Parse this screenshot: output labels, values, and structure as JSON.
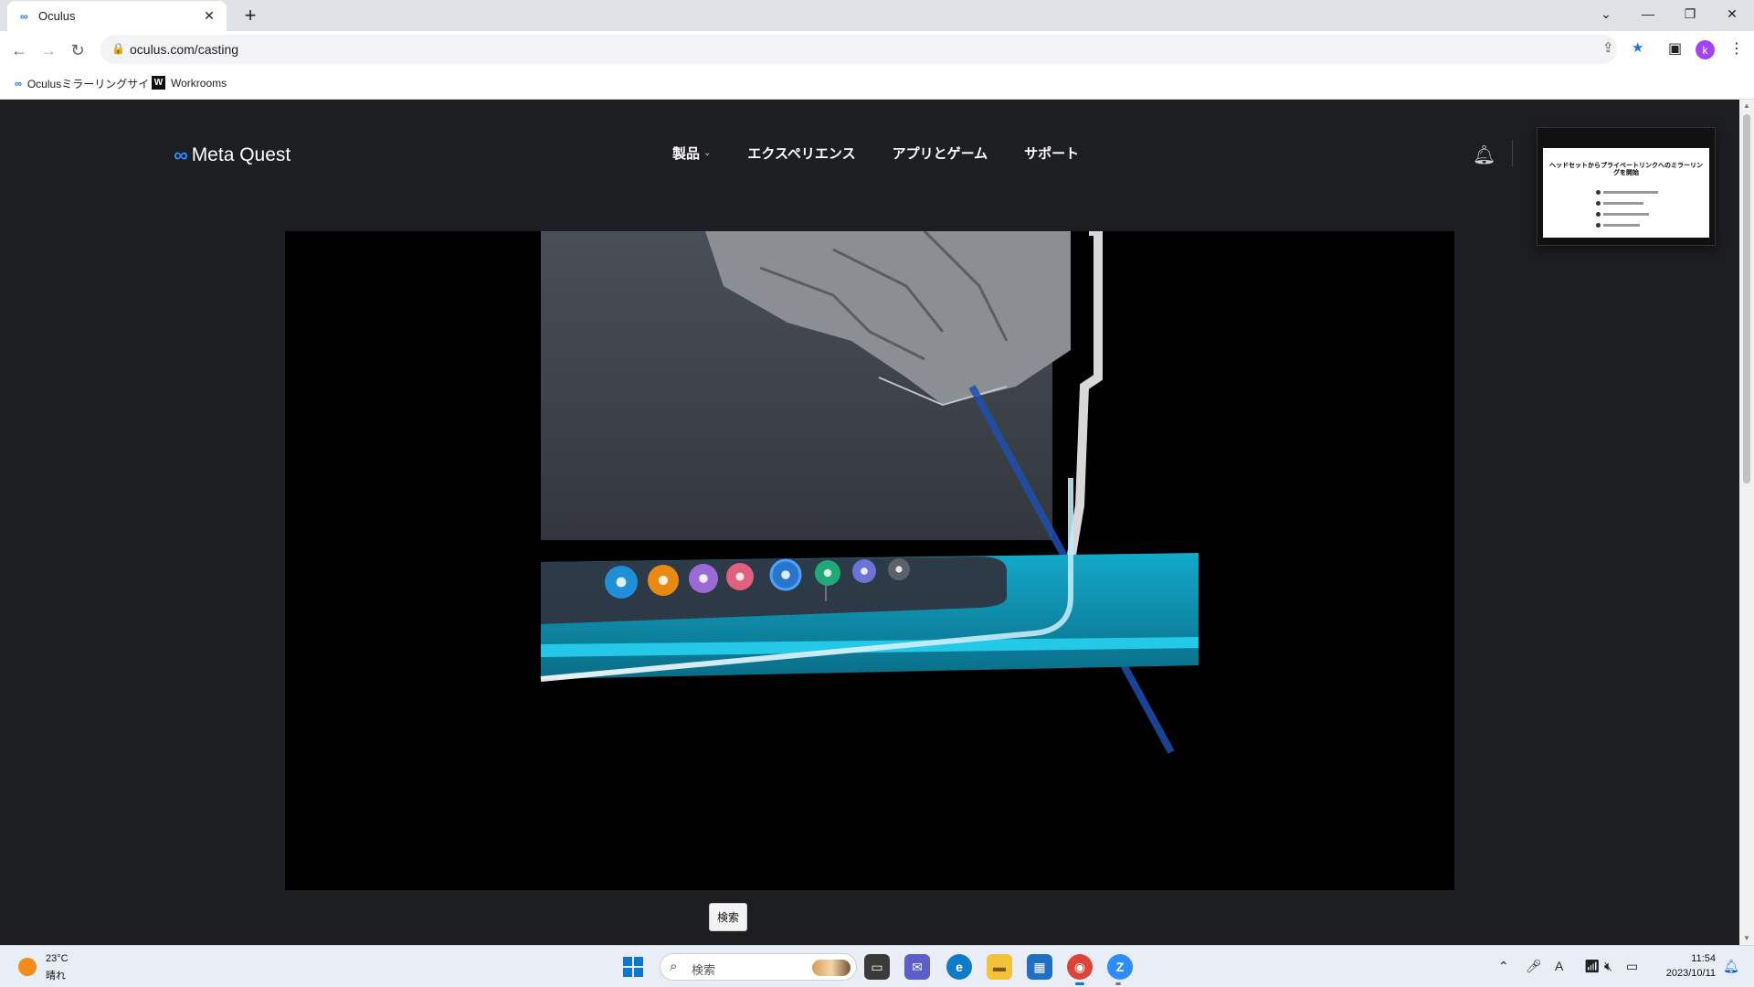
{
  "browser": {
    "tab_title": "Oculus",
    "tab_favicon": "∞",
    "new_tab_symbol": "+",
    "url": "oculus.com/casting",
    "avatar_letter": "k",
    "bookmarks": [
      {
        "label": "Oculusミラーリングサイト",
        "icon": "meta-icon"
      },
      {
        "label": "Workrooms",
        "icon": "workrooms-icon"
      }
    ]
  },
  "site": {
    "logo_mark": "∞",
    "logo_text": "Meta Quest",
    "nav": [
      {
        "label": "製品",
        "has_dropdown": true
      },
      {
        "label": "エクスペリエンス"
      },
      {
        "label": "アプリとゲーム"
      },
      {
        "label": "サポート"
      }
    ],
    "preview_title": "ヘッドセットからプライベートリンクへのミラーリングを開始"
  },
  "vr_dock": {
    "icons": [
      {
        "name": "store-icon",
        "color": "#1f8fd8"
      },
      {
        "name": "shop-bag-icon",
        "color": "#e88a12"
      },
      {
        "name": "people-icon",
        "color": "#9a6bd6"
      },
      {
        "name": "camera-icon",
        "color": "#e0607e"
      },
      {
        "name": "game-app-icon",
        "color": "#2a74c9"
      },
      {
        "name": "record-icon",
        "color": "#1faa78"
      },
      {
        "name": "quest-app-icon",
        "color": "#6b73d6"
      },
      {
        "name": "app-grid-icon",
        "color": "#5d6269"
      }
    ]
  },
  "tooltip": "検索",
  "taskbar": {
    "weather_temp": "23°C",
    "weather_desc": "晴れ",
    "search_placeholder": "検索",
    "time": "11:54",
    "date": "2023/10/11",
    "ime": "A"
  }
}
